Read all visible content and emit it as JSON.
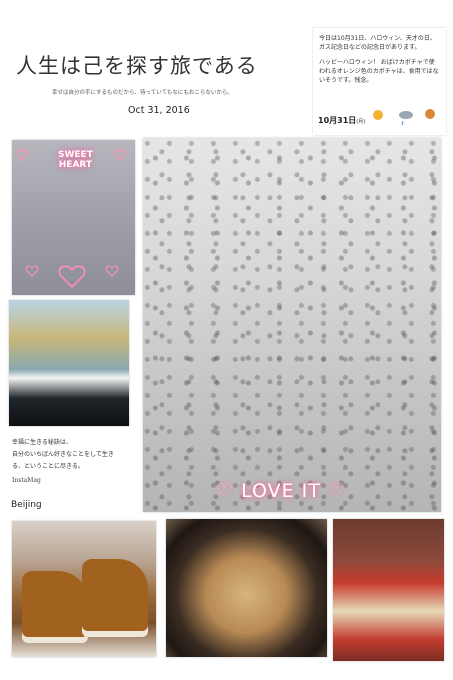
{
  "header": {
    "title": "人生は己を探す旅である",
    "subtitle": "幸せは自分の手にするものだから、待っていてもなにもおこらないから。",
    "date": "Oct 31, 2016"
  },
  "news_card": {
    "paragraph1": "今日は10月31日、ハロウィン、天才の日、ガス記念日などの記念日があります。",
    "paragraph2": "ハッピーハロウィン！ おばけカボチャで使われるオレンジ色のカボチャは、食用ではないそうです。残念。",
    "weather_month": "10月",
    "weather_day": "31日",
    "weather_weekday": "(月)"
  },
  "photos": {
    "sweet_heart_text_line1": "SWEET",
    "sweet_heart_text_line2": "HEART",
    "love_it_text": "LOVE IT"
  },
  "caption": {
    "quote_line1": "幸福に生きる秘訣は、",
    "quote_line2": "自分のいちばん好きなことをして生き",
    "quote_line3": "る、ということに尽きる。",
    "app_name": "InstaMag",
    "city": "Beijing"
  }
}
